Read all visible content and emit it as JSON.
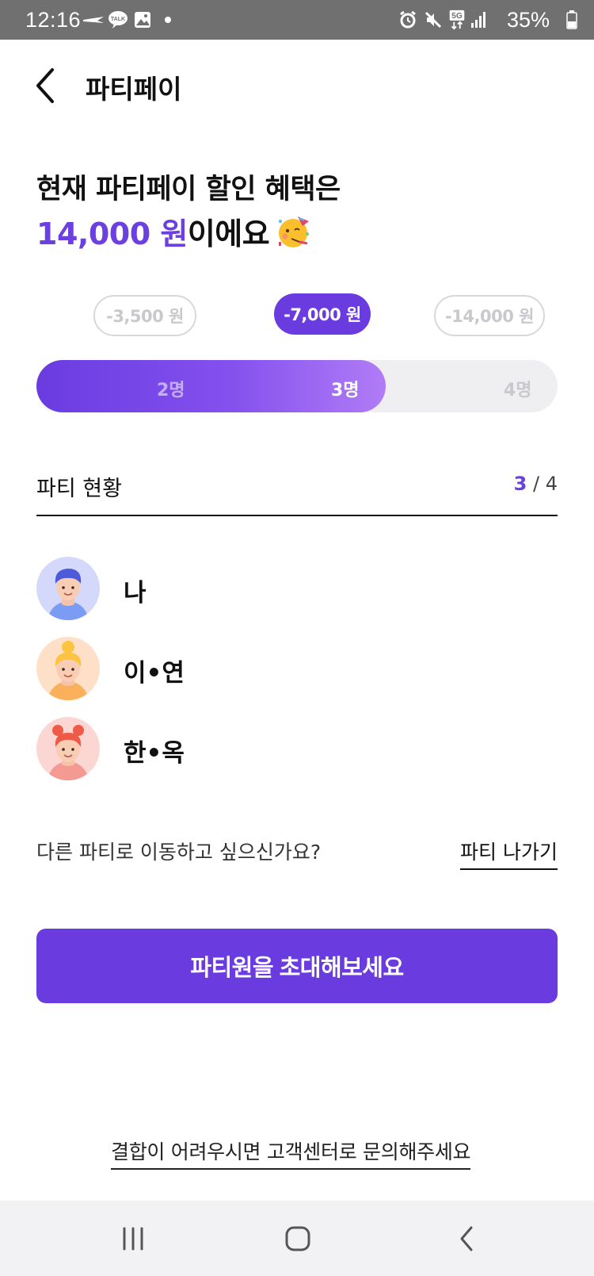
{
  "status_bar": {
    "time": "12:16",
    "network": "5G",
    "battery": "35%",
    "icons": [
      "flight-app-icon",
      "kakaotalk-icon",
      "gallery-icon",
      "dot-icon",
      "alarm-icon",
      "mute-icon",
      "5g-icon",
      "signal-icon",
      "battery-icon"
    ]
  },
  "header": {
    "title": "파티페이",
    "back_icon": "chevron-left-icon"
  },
  "headline": {
    "line1": "현재 파티페이 할인 혜택은",
    "amount": "14,000 원",
    "suffix": "이에요",
    "emoji": "party-face-icon"
  },
  "discount_tiers": [
    {
      "label": "-3,500 원",
      "selected": false
    },
    {
      "label": "-7,000 원",
      "selected": true
    },
    {
      "label": "-14,000 원",
      "selected": false
    }
  ],
  "member_steps": {
    "labels": [
      "2명",
      "3명",
      "4명"
    ],
    "current_index": 1,
    "fill_fraction": 0.67
  },
  "party_status": {
    "title": "파티 현황",
    "current": "3",
    "separator": " / ",
    "total": "4"
  },
  "members": [
    {
      "name": "나",
      "avatar": "boy-avatar-icon",
      "bg": "#d4d9fb"
    },
    {
      "name": "이•연",
      "avatar": "blonde-girl-avatar-icon",
      "bg": "#fde0c7"
    },
    {
      "name": "한•옥",
      "avatar": "red-hair-girl-avatar-icon",
      "bg": "#fcd6d2"
    }
  ],
  "move_party": {
    "question": "다른 파티로 이동하고 싶으신가요?",
    "leave_label": "파티 나가기"
  },
  "invite_button": "파티원을 초대해보세요",
  "contact_link": "결합이 어려우시면 고객센터로 문의해주세요",
  "colors": {
    "accent": "#6a3ce0",
    "accent_light": "#b07cf6",
    "status_bar": "#707070",
    "nav_bar": "#f2f2f4"
  },
  "nav_bar": [
    "recent-apps-icon",
    "home-icon",
    "back-icon"
  ]
}
